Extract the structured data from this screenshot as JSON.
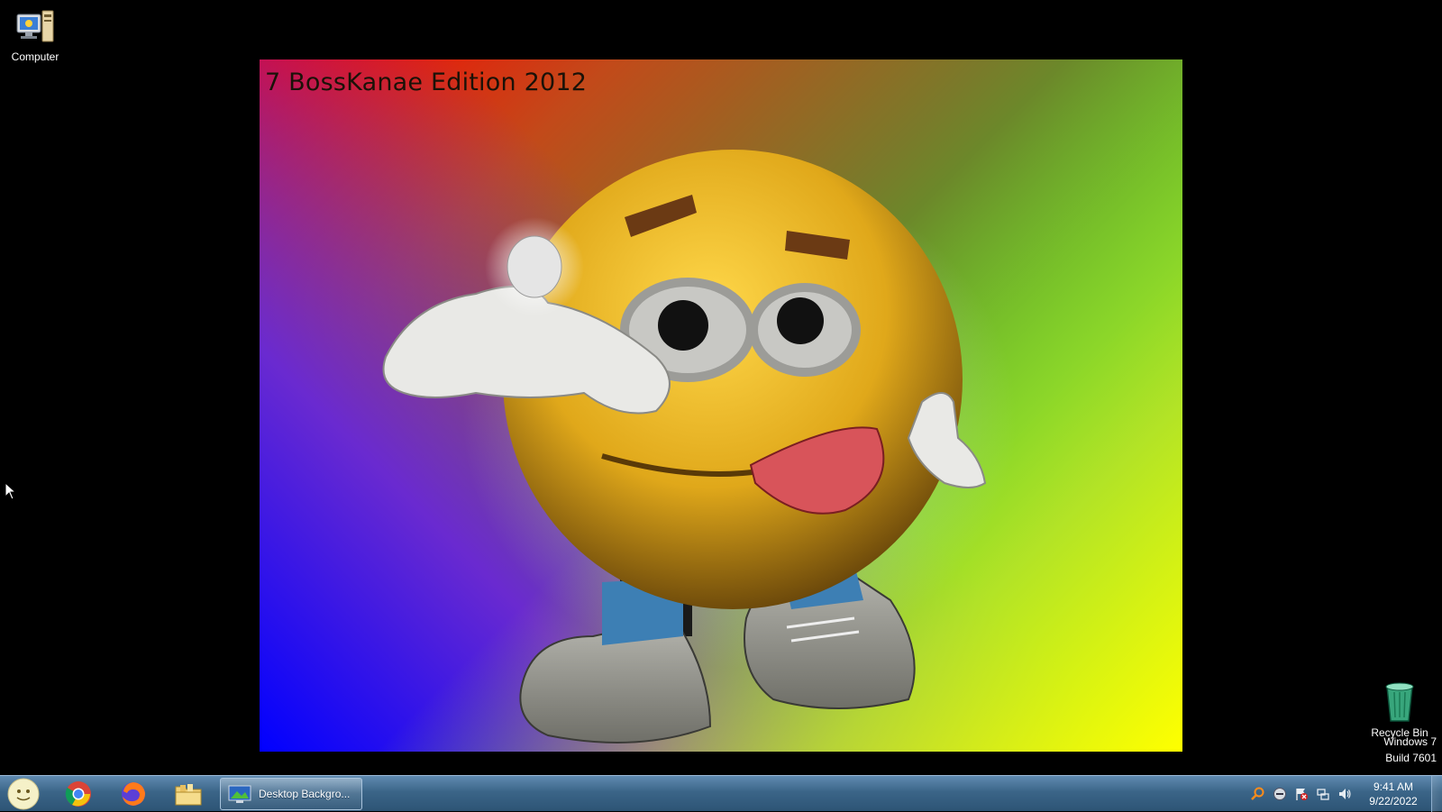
{
  "desktop": {
    "icons": {
      "computer": {
        "label": "Computer",
        "icon": "computer-icon"
      },
      "recycle_bin": {
        "label": "Recycle Bin",
        "icon": "recycle-bin-icon"
      }
    },
    "wallpaper": {
      "title": "7 BossKanae Edition 2012",
      "art": "smiley-face-tongue-out-character"
    },
    "watermark": {
      "line1": "Windows 7",
      "line2": "Build 7601"
    }
  },
  "taskbar": {
    "start": {
      "icon": "start-orb-smiley-icon"
    },
    "pinned": [
      {
        "name": "Google Chrome",
        "icon": "chrome-icon"
      },
      {
        "name": "Firefox",
        "icon": "firefox-icon"
      },
      {
        "name": "Windows Explorer",
        "icon": "folder-icon"
      }
    ],
    "open_window": {
      "label": "Desktop Backgro...",
      "icon": "desktop-background-icon"
    },
    "tray": {
      "icons": [
        "search-icon",
        "minus-circle-icon",
        "flag-error-icon",
        "network-icon",
        "volume-icon"
      ],
      "time": "9:41 AM",
      "date": "9/22/2022"
    }
  },
  "colors": {
    "taskbar_top": "#5f8ab0",
    "taskbar_bottom": "#2d5475",
    "wallpaper_red": "#ff0000",
    "wallpaper_green": "#22ff00",
    "wallpaper_blue": "#0000ff",
    "wallpaper_yellow": "#ffff00"
  }
}
